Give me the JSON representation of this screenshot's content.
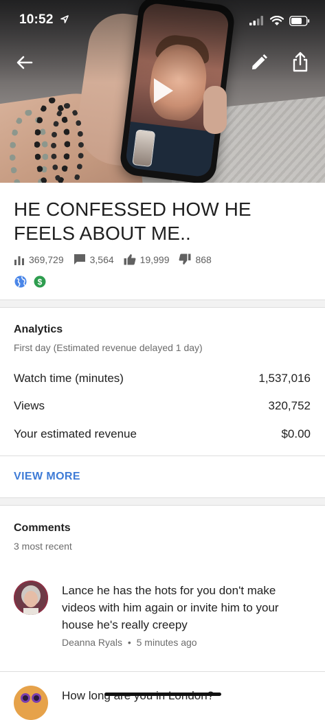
{
  "status_bar": {
    "time": "10:52"
  },
  "video": {
    "title": "HE CONFESSED HOW HE FEELS ABOUT ME..",
    "stats": {
      "views": "369,729",
      "comments": "3,564",
      "likes": "19,999",
      "dislikes": "868"
    }
  },
  "analytics": {
    "title": "Analytics",
    "subtitle": "First day (Estimated revenue delayed 1 day)",
    "rows": [
      {
        "label": "Watch time (minutes)",
        "value": "1,537,016"
      },
      {
        "label": "Views",
        "value": "320,752"
      },
      {
        "label": "Your estimated revenue",
        "value": "$0.00"
      }
    ],
    "view_more_label": "VIEW MORE"
  },
  "comments": {
    "title": "Comments",
    "subtitle": "3 most recent",
    "items": [
      {
        "text": "Lance he has the hots for you don't make videos with him again or invite him to your house he's really creepy",
        "author": "Deanna Ryals",
        "time": "5 minutes ago"
      },
      {
        "text": "How long are you in London?"
      }
    ]
  },
  "colors": {
    "link_blue": "#3e7bd6",
    "public_globe": "#4a86e8",
    "monetized_green": "#2e9d4f"
  }
}
